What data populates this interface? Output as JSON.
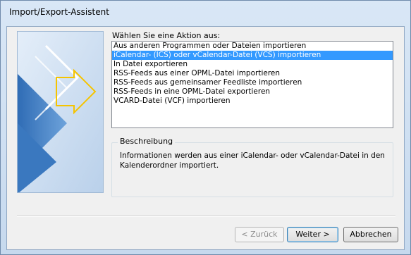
{
  "window": {
    "title": "Import/Export-Assistent"
  },
  "prompt": "Wählen Sie eine Aktion aus:",
  "actions": [
    "Aus anderen Programmen oder Dateien importieren",
    "iCalendar- (ICS) oder vCalendar-Datei (VCS) importieren",
    "In Datei exportieren",
    "RSS-Feeds aus einer OPML-Datei importieren",
    "RSS-Feeds aus gemeinsamer Feedliste importieren",
    "RSS-Feeds in eine OPML-Datei exportieren",
    "VCARD-Datei (VCF) importieren"
  ],
  "selected_action_index": 1,
  "description": {
    "label": "Beschreibung",
    "text": "Informationen werden aus einer iCalendar- oder vCalendar-Datei in den Kalenderordner importiert."
  },
  "buttons": {
    "back": "< Zurück",
    "next": "Weiter >",
    "cancel": "Abbrechen"
  },
  "colors": {
    "selection": "#3399ff",
    "accent_arrow": "#f5c400",
    "panel_blue": "#4a86c5"
  },
  "icons": [
    "wizard-arrows-graphic"
  ]
}
